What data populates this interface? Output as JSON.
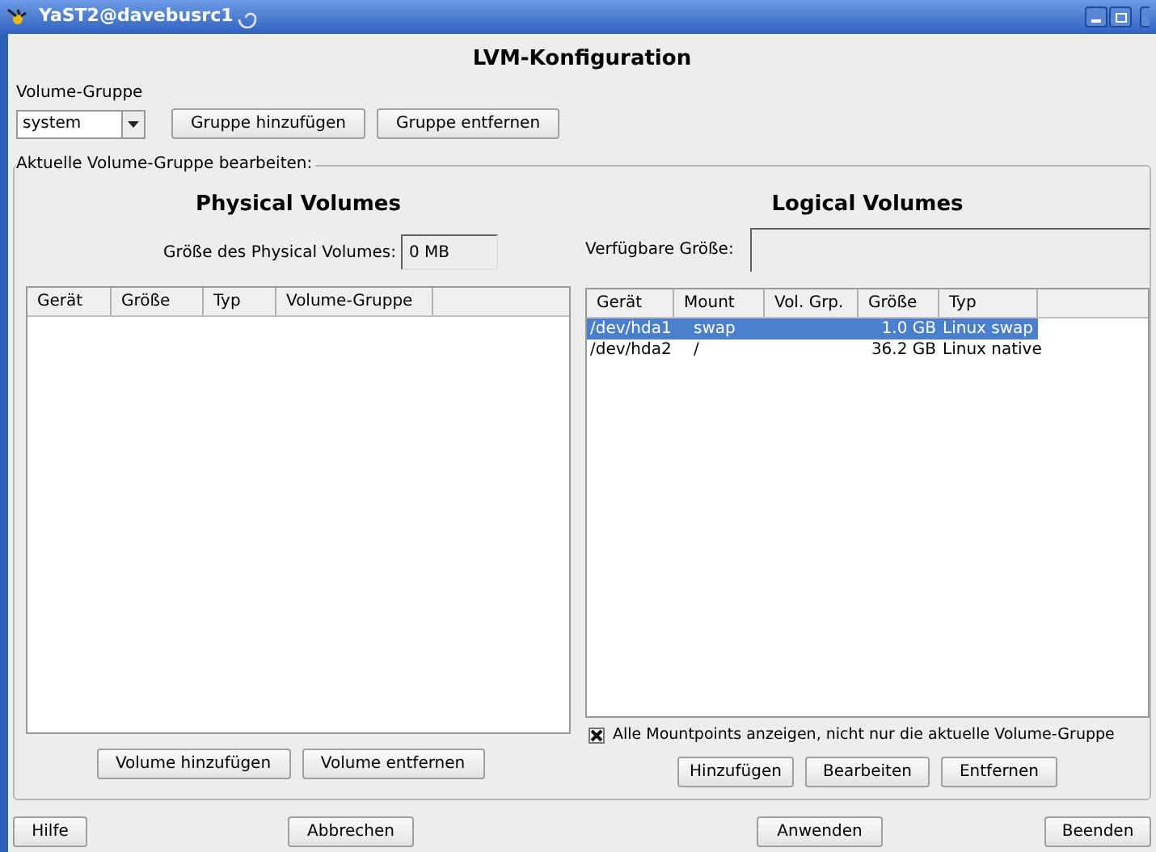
{
  "window": {
    "title": "YaST2@davebusrc1"
  },
  "heading": "LVM-Konfiguration",
  "volume_group": {
    "label": "Volume-Gruppe",
    "value": "system",
    "buttons": [
      "Gruppe hinzufügen",
      "Gruppe entfernen"
    ]
  },
  "group_box": {
    "title": "Aktuelle Volume-Gruppe bearbeiten:"
  },
  "physical_volumes": {
    "title": "Physical Volumes",
    "size_label": "Größe des Physical Volumes:",
    "size_value": "0 MB",
    "table": {
      "columns": [
        "Gerät",
        "Größe",
        "Typ",
        "Volume-Gruppe"
      ]
    },
    "buttons": [
      "Volume hinzufügen",
      "Volume entfernen"
    ]
  },
  "logical_volumes": {
    "title": "Logical Volumes",
    "available_label": "Verfügbare Größe:",
    "table": {
      "columns": [
        "Gerät",
        "Mount",
        "Vol. Grp.",
        "Größe",
        "Typ"
      ],
      "rows": [
        {
          "cells": [
            "/dev/hda1",
            "swap",
            "",
            "1.0 GB",
            "Linux swap"
          ],
          "selected": true
        },
        {
          "cells": [
            "/dev/hda2",
            "/",
            "",
            "36.2 GB",
            "Linux native"
          ],
          "selected": false
        }
      ]
    },
    "show_all": {
      "label": "Alle Mountpoints anzeigen, nicht nur die aktuelle Volume-Gruppe",
      "checked": true
    },
    "buttons": [
      "Hinzufügen",
      "Bearbeiten",
      "Entfernen"
    ]
  },
  "bottom_buttons": [
    "Hilfe",
    "Abbrechen",
    "Anwenden",
    "Beenden"
  ]
}
